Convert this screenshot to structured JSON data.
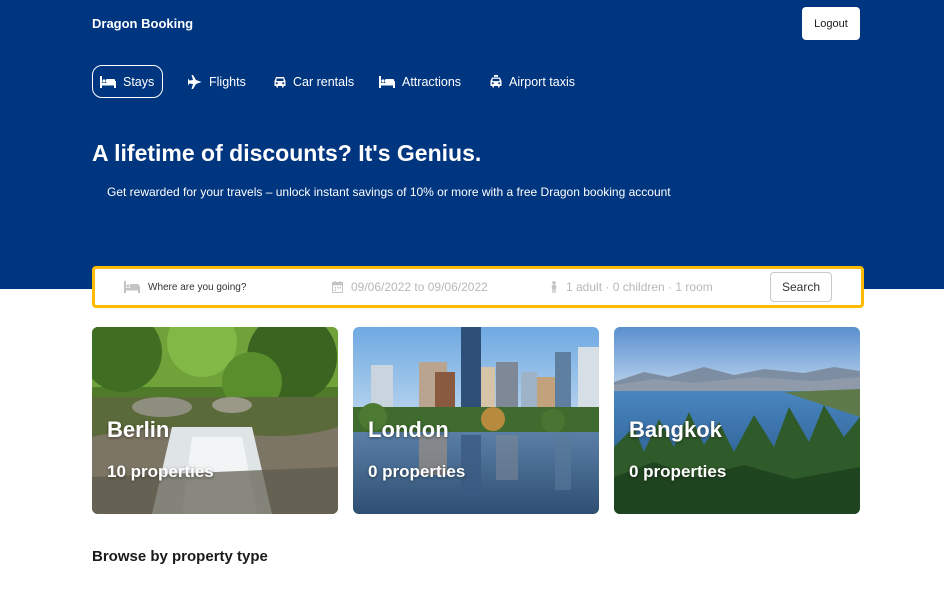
{
  "header": {
    "brand": "Dragon Booking",
    "logout_label": "Logout"
  },
  "nav": {
    "items": [
      {
        "label": "Stays",
        "icon": "bed-icon",
        "active": true
      },
      {
        "label": "Flights",
        "icon": "plane-icon",
        "active": false
      },
      {
        "label": "Car rentals",
        "icon": "car-icon",
        "active": false
      },
      {
        "label": "Attractions",
        "icon": "bed-icon",
        "active": false
      },
      {
        "label": "Airport taxis",
        "icon": "taxi-icon",
        "active": false
      }
    ]
  },
  "hero": {
    "title": "A lifetime of discounts? It's Genius.",
    "subtitle": "Get rewarded for your travels – unlock instant savings of 10% or more with a free Dragon booking account"
  },
  "search": {
    "destination_placeholder": "Where are you going?",
    "dates": "09/06/2022 to 09/06/2022",
    "guests": "1 adult · 0 children · 1 room",
    "button_label": "Search"
  },
  "featured": [
    {
      "city": "Berlin",
      "count": "10 properties"
    },
    {
      "city": "London",
      "count": "0 properties"
    },
    {
      "city": "Bangkok",
      "count": "0 properties"
    }
  ],
  "sections": {
    "browse_title": "Browse by property type"
  },
  "colors": {
    "hero_bg": "#003580",
    "search_border": "#febb02",
    "text": "#1a1a1a"
  }
}
